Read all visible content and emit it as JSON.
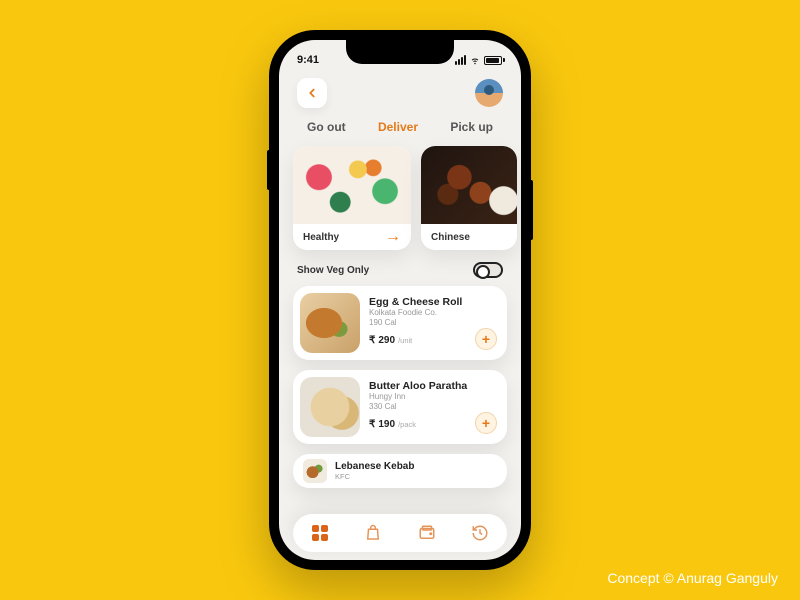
{
  "credit": "Concept © Anurag Ganguly",
  "status": {
    "time": "9:41"
  },
  "tabs": [
    {
      "label": "Go out",
      "active": false
    },
    {
      "label": "Deliver",
      "active": true
    },
    {
      "label": "Pick up",
      "active": false
    }
  ],
  "categories": [
    {
      "name": "Healthy",
      "show_arrow": true
    },
    {
      "name": "Chinese",
      "show_arrow": false
    }
  ],
  "veg_toggle": {
    "label": "Show Veg Only",
    "on": false
  },
  "currency": "₹",
  "items": [
    {
      "name": "Egg & Cheese Roll",
      "vendor": "Kolkata Foodie Co.",
      "calories": "190 Cal",
      "price": "290",
      "unit": "/unit"
    },
    {
      "name": "Butter Aloo Paratha",
      "vendor": "Hungy Inn",
      "calories": "330 Cal",
      "price": "190",
      "unit": "/pack"
    },
    {
      "name": "Lebanese Kebab",
      "vendor": "KFC"
    }
  ],
  "nav": [
    {
      "name": "home-grid",
      "active": true
    },
    {
      "name": "bag",
      "active": false
    },
    {
      "name": "wallet",
      "active": false
    },
    {
      "name": "history",
      "active": false
    }
  ],
  "colors": {
    "accent": "#e57a1a",
    "page_bg": "#f9c80e",
    "screen_bg": "#f3f1ee"
  }
}
